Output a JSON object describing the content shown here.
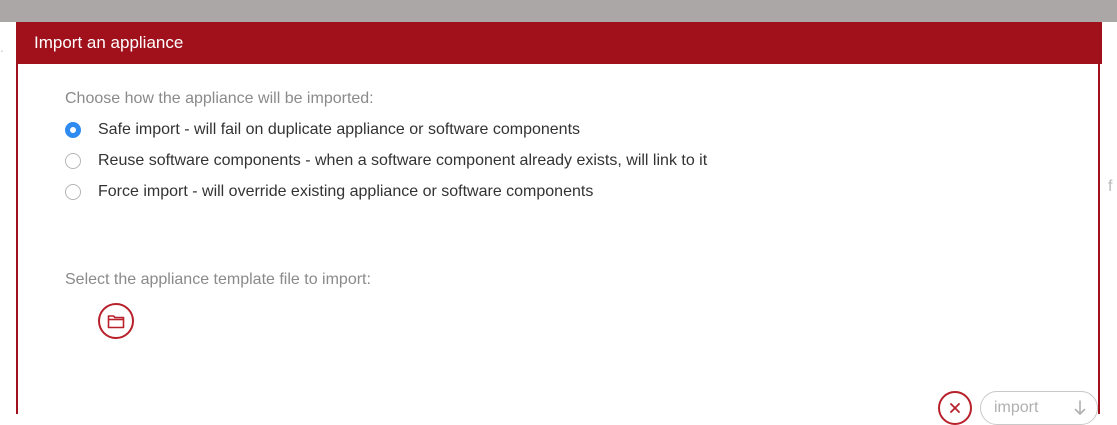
{
  "dialog": {
    "title": "Import an appliance",
    "import_mode": {
      "prompt": "Choose how the appliance will be imported:",
      "selected": "safe",
      "options": [
        {
          "id": "safe",
          "label": "Safe import - will fail on duplicate appliance or software components",
          "checked": true
        },
        {
          "id": "reuse",
          "label": "Reuse software components - when a software component already exists, will link to it",
          "checked": false
        },
        {
          "id": "force",
          "label": "Force import - will override existing appliance or software components",
          "checked": false
        }
      ]
    },
    "file": {
      "prompt": "Select the appliance template file to import:",
      "icon": "folder-icon"
    },
    "footer": {
      "close_icon": "close-icon",
      "import_label": "import",
      "import_icon": "arrow-down-icon",
      "import_enabled": false
    }
  },
  "background": {
    "stray_right": "f",
    "stray_left": "."
  },
  "colors": {
    "brand": "#a0111b",
    "radio_selected": "#2f8bf0",
    "backdrop": "#aba7a7"
  }
}
